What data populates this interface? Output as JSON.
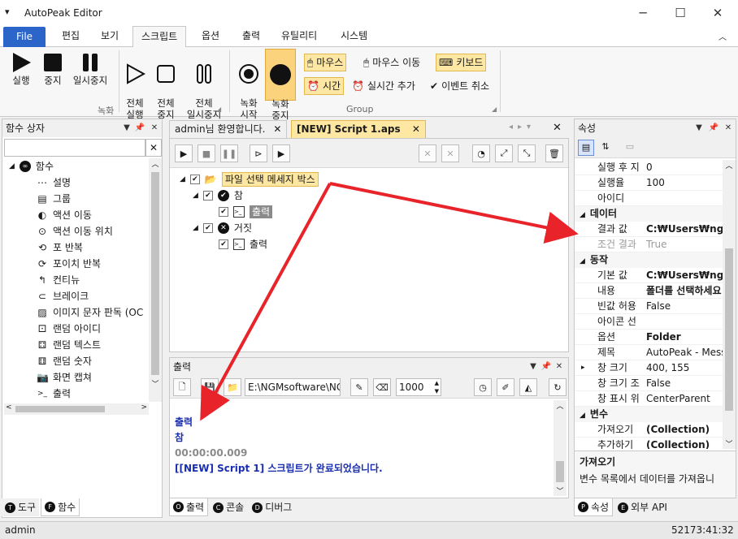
{
  "app": {
    "title": "AutoPeak Editor",
    "min_icon": "─",
    "max_icon": "☐",
    "close_icon": "✕"
  },
  "ribbon_tabs": [
    "File",
    "편집",
    "보기",
    "스크립트",
    "옵션",
    "출력",
    "유틸리티",
    "시스템"
  ],
  "ribbon": {
    "rec_group_label": "녹화",
    "group_label": "Group",
    "run": "실행",
    "stop": "중지",
    "pause": "일시중지",
    "all_run": "전체\n실행",
    "all_stop": "전체\n중지",
    "all_pause": "전체\n일시중지",
    "rec_start": "녹화\n시작",
    "rec_stop": "녹화\n중지",
    "mouse": "마우스",
    "mouse_move": "마우스 이동",
    "keyboard": "키보드",
    "time": "시간",
    "realtime_add": "실시간 추가",
    "event_cancel": "이벤트 취소"
  },
  "left_panel": {
    "title": "함수 상자",
    "root": "함수",
    "items": [
      "설명",
      "그룹",
      "액션 이동",
      "액션 이동 위치",
      "포 반복",
      "포이치 반복",
      "컨티뉴",
      "브레이크",
      "이미지 문자 판독 (OC",
      "랜덤 아이디",
      "랜덤 텍스트",
      "랜덤 숫자",
      "화면 캡쳐",
      "출력"
    ],
    "bottom_tabs": [
      {
        "label": "도구",
        "letter": "T"
      },
      {
        "label": "함수",
        "letter": "F"
      }
    ]
  },
  "doc_tabs": [
    "admin님 환영합니다.",
    "[NEW] Script 1.aps"
  ],
  "script_tree": {
    "root": "파일 선택 메세지 박스",
    "true_label": "참",
    "false_label": "거짓",
    "output1": "출력",
    "output2": "출력"
  },
  "output_panel": {
    "title": "출력",
    "path": "E:\\NGMsoftware\\NG",
    "number": "1000",
    "lines": [
      "출력",
      "참",
      "00:00:00.009",
      "[[NEW] Script 1] 스크립트가 완료되었습니다."
    ],
    "bottom_tabs": [
      {
        "label": "출력",
        "letter": "O"
      },
      {
        "label": "콘솔",
        "letter": "C"
      },
      {
        "label": "디버그",
        "letter": "D"
      }
    ]
  },
  "props_panel": {
    "title": "속성",
    "rows_top": [
      {
        "name": "실행 후 지",
        "value": "0"
      },
      {
        "name": "실행율",
        "value": "100"
      },
      {
        "name": "아이디",
        "value": ""
      }
    ],
    "cat_data": "데이터",
    "rows_data": [
      {
        "name": "결과 값",
        "value": "C:₩Users₩ngma"
      },
      {
        "name": "조건 결과",
        "value": "True"
      }
    ],
    "cat_action": "동작",
    "rows_action": [
      {
        "name": "기본 값",
        "value": "C:₩Users₩ngmа"
      },
      {
        "name": "내용",
        "value": "폴더를 선택하세요"
      },
      {
        "name": "빈값 허용",
        "value": "False"
      },
      {
        "name": "아이콘 선",
        "value": ""
      },
      {
        "name": "옵션",
        "value": "Folder"
      },
      {
        "name": "제목",
        "value": "AutoPeak - Messa"
      },
      {
        "name": "창 크기",
        "value": "400, 155"
      },
      {
        "name": "창 크기 조",
        "value": "False"
      },
      {
        "name": "창 표시 위",
        "value": "CenterParent"
      }
    ],
    "cat_var": "변수",
    "rows_var": [
      {
        "name": "가져오기",
        "value": "(Collection)"
      },
      {
        "name": "추가하기",
        "value": "(Collection)"
      }
    ],
    "desc_title": "가져오기",
    "desc_text": "변수 목록에서 데이터를 가져옵니",
    "bottom_tabs": [
      {
        "label": "속성",
        "letter": "P"
      },
      {
        "label": "외부 API",
        "letter": "E"
      }
    ]
  },
  "status": {
    "user": "admin",
    "time": "52173:41:32"
  },
  "colors": {
    "accent": "#2b65c9",
    "highlight": "#fde7a3",
    "arrow": "#e8232a",
    "output_text": "#1a2fb0"
  }
}
